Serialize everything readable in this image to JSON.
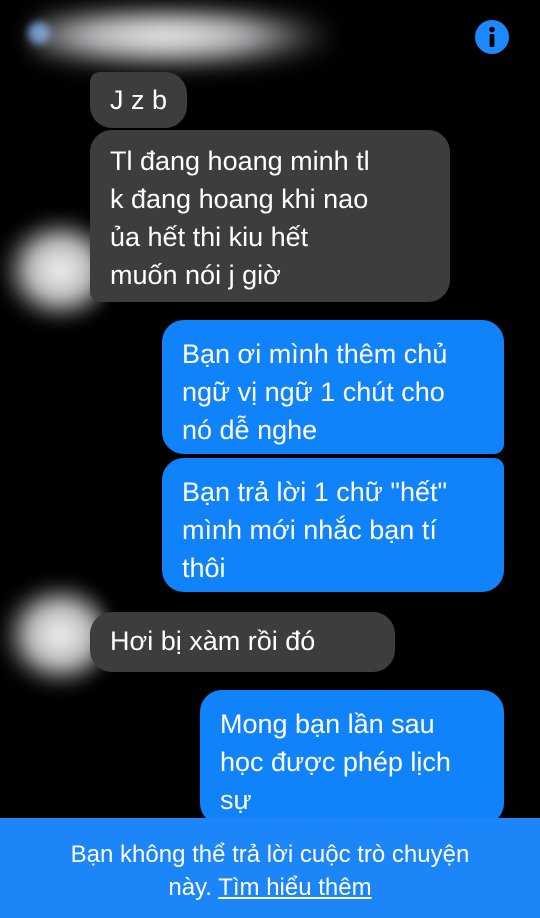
{
  "header": {
    "info_icon": "info-icon",
    "accent_color": "#1e88ff"
  },
  "messages": [
    {
      "from": "contact",
      "lines": [
        "J z b"
      ]
    },
    {
      "from": "contact",
      "lines": [
        "Tl  đang hoang minh tl",
        "k đang hoang khi nao",
        "ủa  hết  thi kiu  hết",
        "muốn  nói  j giờ"
      ]
    },
    {
      "from": "me",
      "lines": [
        "Bạn ơi mình thêm chủ",
        "ngữ vị ngữ 1 chút cho",
        "nó dễ nghe"
      ]
    },
    {
      "from": "me",
      "lines": [
        "Bạn trả lời 1 chữ \"hết\"",
        "mình mới nhắc bạn tí",
        "thôi"
      ]
    },
    {
      "from": "contact",
      "lines": [
        "Hơi  bị  xàm  rồi  đó"
      ]
    },
    {
      "from": "me",
      "lines": [
        "Mong bạn lần sau",
        "học được phép lịch",
        "sự"
      ]
    }
  ],
  "footer": {
    "line1": "Bạn không thể trả lời cuộc trò chuyện",
    "line2_prefix": "này. ",
    "link": "Tìm hiểu thêm"
  },
  "colors": {
    "received_bubble": "#3d3d3f",
    "sent_bubble": "#1083fb",
    "footer_bg": "#1c86f9",
    "background": "#000000"
  }
}
